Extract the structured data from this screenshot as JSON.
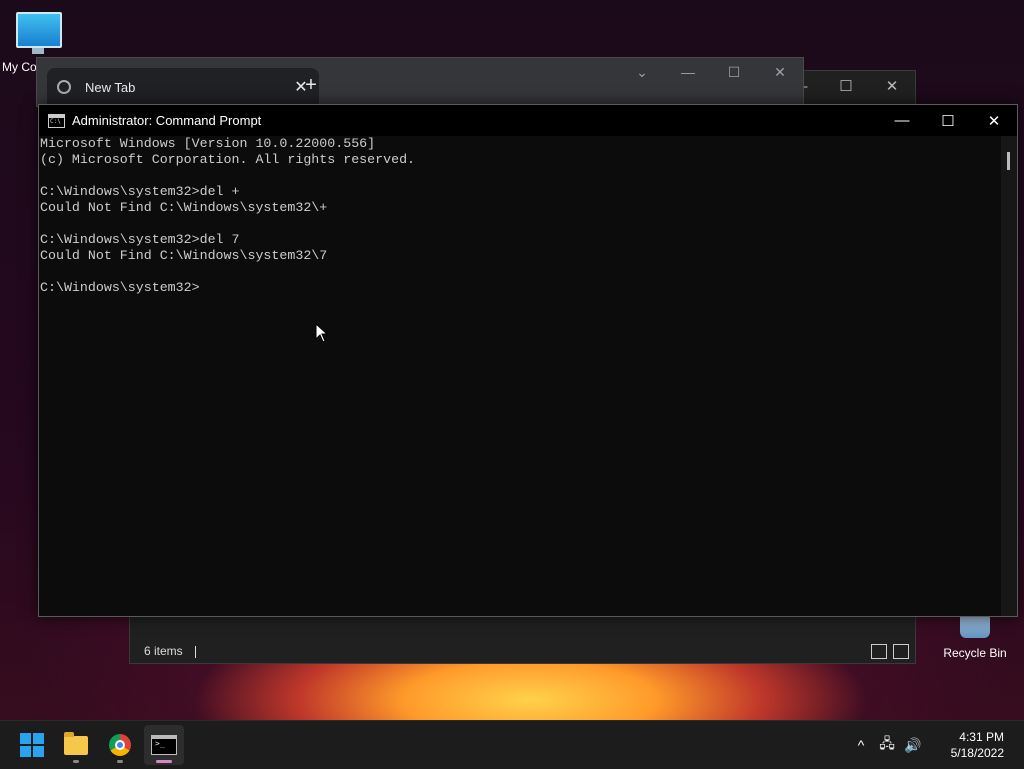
{
  "desktop": {
    "icons": [
      {
        "label": "My Co"
      },
      {
        "label": "Recycle Bin"
      }
    ]
  },
  "explorer": {
    "status_text": "6 items",
    "controls": [
      "—",
      "☐",
      "✕"
    ]
  },
  "chrome": {
    "tab_title": "New Tab",
    "tab_close": "✕",
    "new_tab": "+",
    "controls": [
      "⌄",
      "—",
      "☐",
      "✕"
    ]
  },
  "cmd": {
    "title": "Administrator: Command Prompt",
    "controls": {
      "minimize": "—",
      "maximize": "☐",
      "close": "✕"
    },
    "lines": [
      "Microsoft Windows [Version 10.0.22000.556]",
      "(c) Microsoft Corporation. All rights reserved.",
      "",
      "C:\\Windows\\system32>del +",
      "Could Not Find C:\\Windows\\system32\\+",
      "",
      "C:\\Windows\\system32>del 7",
      "Could Not Find C:\\Windows\\system32\\7",
      "",
      "C:\\Windows\\system32>"
    ]
  },
  "taskbar": {
    "apps": [
      {
        "name": "start",
        "icon": "windows-logo"
      },
      {
        "name": "file-explorer",
        "icon": "folder-icon"
      },
      {
        "name": "chrome",
        "icon": "chrome-icon"
      },
      {
        "name": "command-prompt",
        "icon": "cmd-icon",
        "active": true
      }
    ],
    "tray": {
      "chevron": "^",
      "network": "🖧",
      "volume": "🔊"
    },
    "clock": {
      "time": "4:31 PM",
      "date": "5/18/2022"
    }
  },
  "colors": {
    "cmd_text": "#cccccc",
    "cmd_bg": "#0c0c0c",
    "taskbar_bg": "#1c1c1c",
    "accent": "#2aa3ee"
  }
}
